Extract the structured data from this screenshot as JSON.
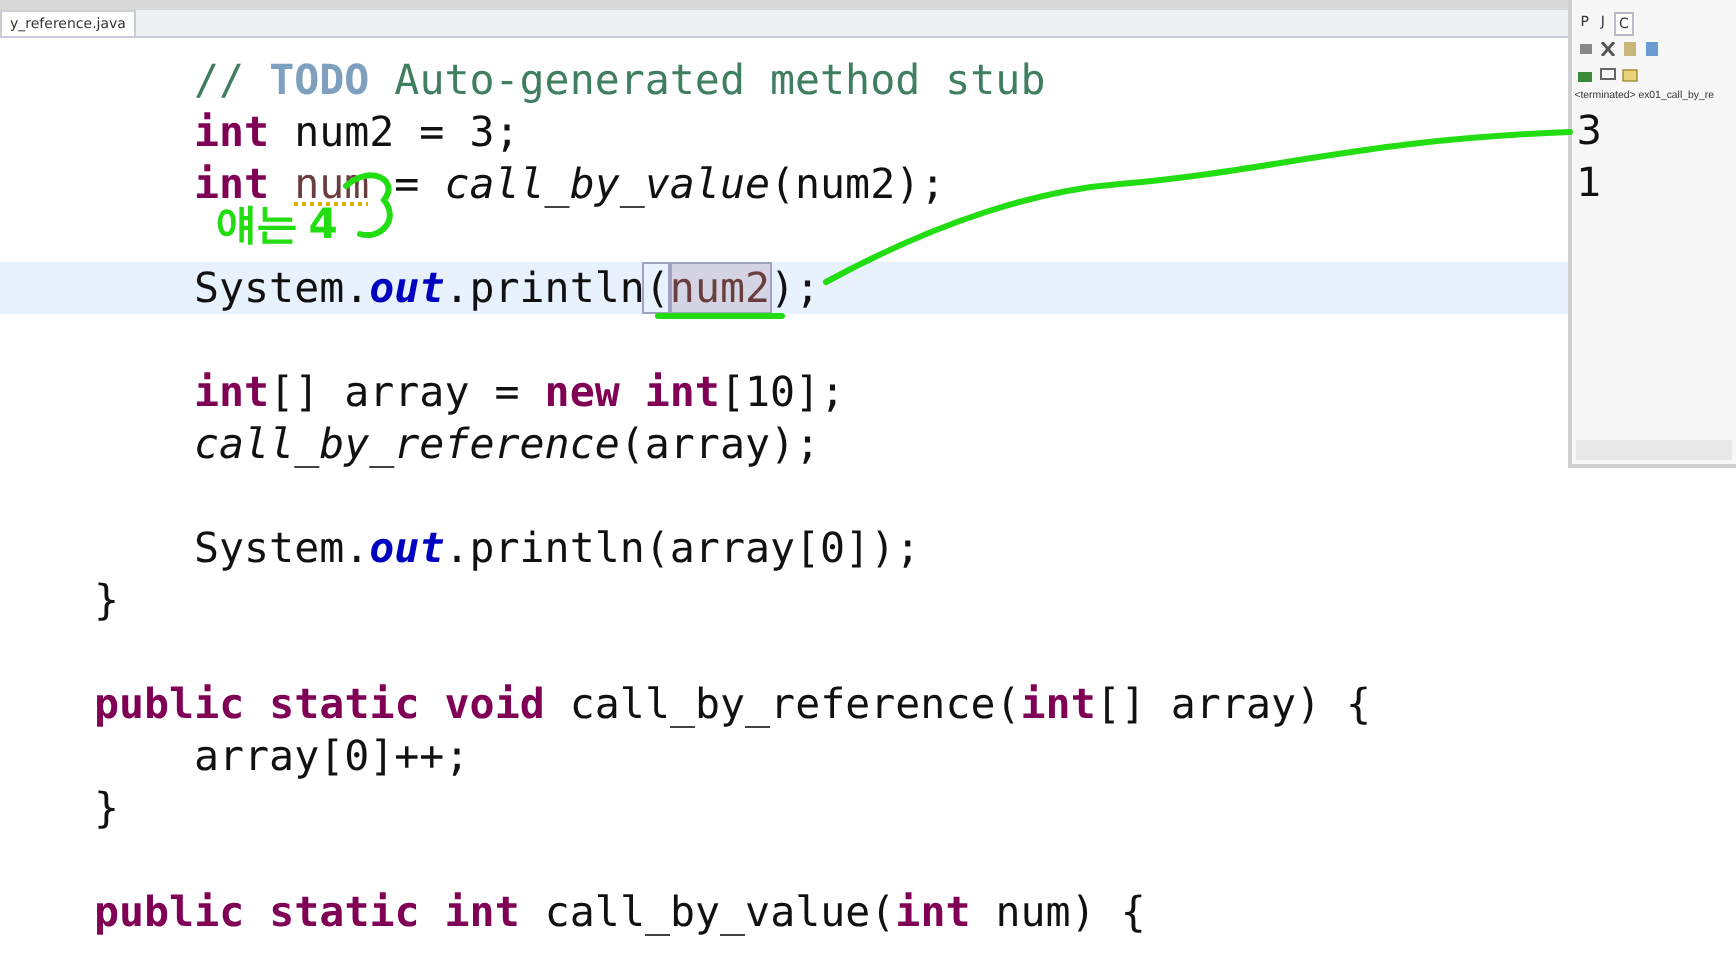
{
  "editor_tab": {
    "title": "y_reference.java",
    "selected": true
  },
  "code_lines": [
    {
      "indented": true,
      "blank_before": false,
      "highlighted": false,
      "tokens": [
        {
          "kind": "comment",
          "text": "// "
        },
        {
          "kind": "todo",
          "text": "TODO"
        },
        {
          "kind": "comment",
          "text": " Auto-generated method stub"
        }
      ]
    },
    {
      "indented": true,
      "blank_before": false,
      "highlighted": false,
      "tokens": [
        {
          "kind": "keyword",
          "text": "int"
        },
        {
          "kind": "plain",
          "text": " num2 = 3;"
        }
      ]
    },
    {
      "indented": true,
      "blank_before": false,
      "highlighted": false,
      "tokens": [
        {
          "kind": "keyword",
          "text": "int "
        },
        {
          "kind": "warning",
          "text": "num"
        },
        {
          "kind": "plain",
          "text": " = "
        },
        {
          "kind": "static-call",
          "text": "call_by_value"
        },
        {
          "kind": "plain",
          "text": "(num2);"
        }
      ]
    },
    {
      "indented": true,
      "blank_before": true,
      "highlighted": true,
      "tokens": [
        {
          "kind": "plain",
          "text": "System."
        },
        {
          "kind": "static-field",
          "text": "out"
        },
        {
          "kind": "plain",
          "text": ".println"
        },
        {
          "kind": "bracket",
          "text": "("
        },
        {
          "kind": "occurrence",
          "text": "num2"
        },
        {
          "kind": "plain",
          "text": ");"
        }
      ]
    },
    {
      "indented": true,
      "blank_before": true,
      "highlighted": false,
      "tokens": [
        {
          "kind": "keyword",
          "text": "int"
        },
        {
          "kind": "plain",
          "text": "[] array = "
        },
        {
          "kind": "keyword",
          "text": "new int"
        },
        {
          "kind": "plain",
          "text": "[10];"
        }
      ]
    },
    {
      "indented": true,
      "blank_before": false,
      "highlighted": false,
      "tokens": [
        {
          "kind": "static-call",
          "text": "call_by_reference"
        },
        {
          "kind": "plain",
          "text": "(array);"
        }
      ]
    },
    {
      "indented": true,
      "blank_before": true,
      "highlighted": false,
      "tokens": [
        {
          "kind": "plain",
          "text": "System."
        },
        {
          "kind": "static-field",
          "text": "out"
        },
        {
          "kind": "plain",
          "text": ".println(array[0]);"
        }
      ]
    },
    {
      "indented": false,
      "blank_before": false,
      "highlighted": false,
      "tokens": [
        {
          "kind": "plain",
          "text": "}"
        }
      ]
    },
    {
      "indented": false,
      "blank_before": true,
      "highlighted": false,
      "tokens": [
        {
          "kind": "keyword",
          "text": "public static void"
        },
        {
          "kind": "plain",
          "text": " call_by_reference("
        },
        {
          "kind": "keyword",
          "text": "int"
        },
        {
          "kind": "plain",
          "text": "[] array) {"
        }
      ]
    },
    {
      "indented": true,
      "blank_before": false,
      "highlighted": false,
      "tokens": [
        {
          "kind": "plain",
          "text": "array[0]++;"
        }
      ]
    },
    {
      "indented": false,
      "blank_before": false,
      "highlighted": false,
      "tokens": [
        {
          "kind": "plain",
          "text": "}"
        }
      ]
    },
    {
      "indented": false,
      "blank_before": true,
      "highlighted": false,
      "tokens": [
        {
          "kind": "keyword",
          "text": "public static int"
        },
        {
          "kind": "plain",
          "text": " call_by_value("
        },
        {
          "kind": "keyword",
          "text": "int"
        },
        {
          "kind": "plain",
          "text": " num) {"
        }
      ]
    }
  ],
  "annotation": {
    "note": "얘는 4"
  },
  "console": {
    "tabs": [
      {
        "label": "P",
        "selected": false
      },
      {
        "label": "J",
        "selected": false
      },
      {
        "label": "C",
        "selected": true
      }
    ],
    "status": "<terminated> ex01_call_by_re",
    "output": [
      "3",
      "1"
    ]
  }
}
